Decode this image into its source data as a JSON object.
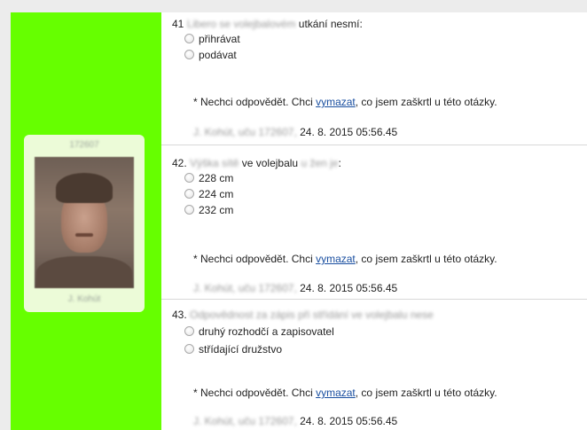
{
  "sidebar": {
    "id_number": "172607",
    "name": "J. Kohút"
  },
  "questions": [
    {
      "number": "41",
      "text_blurred": "Libero se volejbalovém",
      "text_visible": "utkání nesmí:",
      "options": [
        "přihrávat",
        "podávat"
      ],
      "note_prefix": "* Nechci odpovědět. Chci ",
      "note_link": "vymazat",
      "note_suffix": ", co jsem zaškrtl u této otázky.",
      "stamp_blurred": "J. Kohút, uču 172607,",
      "timestamp": "24. 8. 2015 05:56.45"
    },
    {
      "number": "42.",
      "text_blurred": "Výška sítě",
      "text_visible": "ve volejbalu",
      "text_blurred2": "u žen je",
      "text_colon": ":",
      "options": [
        "228 cm",
        "224 cm",
        "232 cm"
      ],
      "note_prefix": "* Nechci odpovědět. Chci ",
      "note_link": "vymazat",
      "note_suffix": ", co jsem zaškrtl u této otázky.",
      "stamp_blurred": "J. Kohút, uču 172607,",
      "timestamp": "24. 8. 2015 05:56.45"
    },
    {
      "number": "43.",
      "text_blurred": "Odpovědnost za zápis při střídání ve volejbalu nese",
      "options": [
        "druhý rozhodčí a zapisovatel",
        "střídající družstvo"
      ],
      "note_prefix": "* Nechci odpovědět. Chci ",
      "note_link": "vymazat",
      "note_suffix": ", co jsem zaškrtl u této otázky.",
      "stamp_blurred": "J. Kohút, uču 172607,",
      "timestamp": "24. 8. 2015 05:56.45"
    }
  ]
}
